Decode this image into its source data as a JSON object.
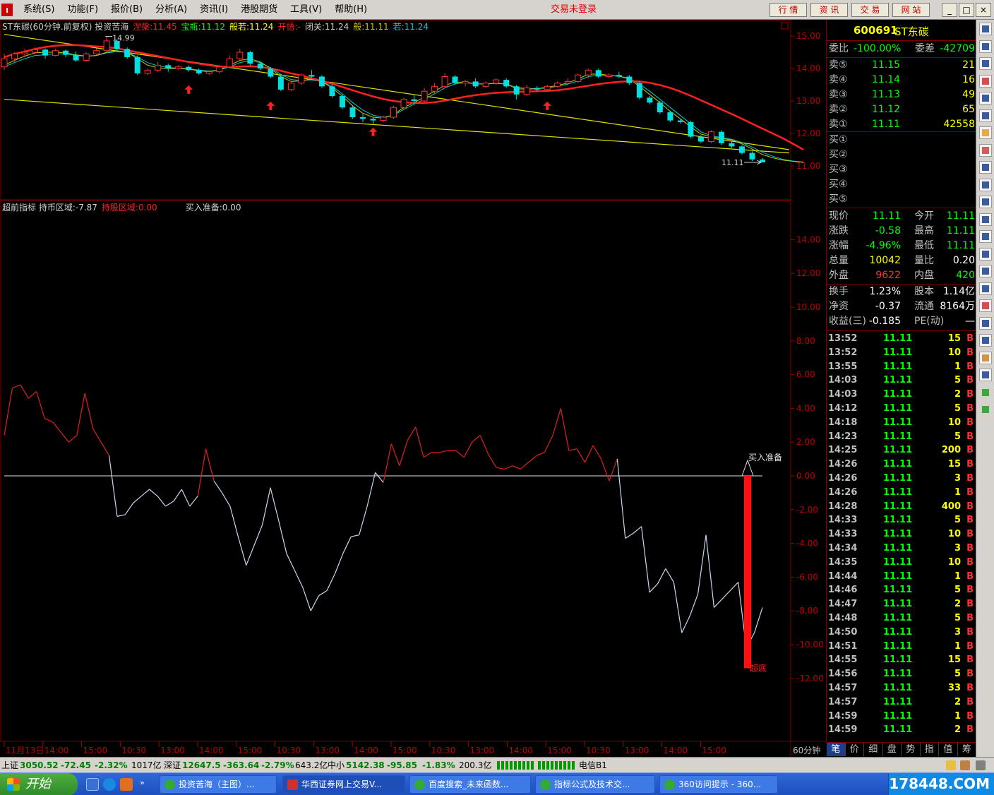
{
  "menubar": {
    "logo": "ı",
    "items": [
      "系统(S)",
      "功能(F)",
      "报价(B)",
      "分析(A)",
      "资讯(I)",
      "港股期货",
      "工具(V)",
      "帮助(H)"
    ],
    "login_status": "交易未登录",
    "nav_buttons": [
      "行 情",
      "资 讯",
      "交 易",
      "网 站"
    ],
    "win_buttons": [
      "_",
      "□",
      "×"
    ]
  },
  "price_chart": {
    "title_parts": [
      {
        "text": "ST东碳(60分钟.前复权) 投资苦海",
        "color": "#d0d0d0"
      },
      {
        "text": "涅槃:11.45",
        "color": "#ff2020"
      },
      {
        "text": "宝瓶:11.12",
        "color": "#00ff00"
      },
      {
        "text": "般若:11.24",
        "color": "#ffff00"
      },
      {
        "text": "开悟:-",
        "color": "#ff2020"
      },
      {
        "text": "闭关:11.24",
        "color": "#d0d0d0"
      },
      {
        "text": "般:11.11",
        "color": "#c8c800"
      },
      {
        "text": "若:11.24",
        "color": "#00cccc"
      }
    ],
    "high_label": "14.99",
    "last_label": "11.11",
    "y_ticks": [
      "15.00",
      "14.00",
      "13.00",
      "12.00",
      "11.00"
    ],
    "candles": [
      {
        "o": 14.05,
        "h": 14.45,
        "l": 13.95,
        "c": 14.3
      },
      {
        "o": 14.3,
        "h": 14.5,
        "l": 14.2,
        "c": 14.45
      },
      {
        "o": 14.45,
        "h": 14.6,
        "l": 14.35,
        "c": 14.5
      },
      {
        "o": 14.5,
        "h": 14.65,
        "l": 14.45,
        "c": 14.58
      },
      {
        "o": 14.58,
        "h": 14.62,
        "l": 14.3,
        "c": 14.4
      },
      {
        "o": 14.4,
        "h": 14.6,
        "l": 14.38,
        "c": 14.55
      },
      {
        "o": 14.55,
        "h": 14.58,
        "l": 14.35,
        "c": 14.42
      },
      {
        "o": 14.42,
        "h": 14.52,
        "l": 14.2,
        "c": 14.25
      },
      {
        "o": 14.25,
        "h": 14.5,
        "l": 14.22,
        "c": 14.45
      },
      {
        "o": 14.45,
        "h": 14.62,
        "l": 14.4,
        "c": 14.55
      },
      {
        "o": 14.55,
        "h": 14.99,
        "l": 14.5,
        "c": 14.85
      },
      {
        "o": 14.85,
        "h": 14.9,
        "l": 14.5,
        "c": 14.6
      },
      {
        "o": 14.6,
        "h": 14.65,
        "l": 14.3,
        "c": 14.35
      },
      {
        "o": 14.35,
        "h": 14.4,
        "l": 13.8,
        "c": 13.85
      },
      {
        "o": 13.85,
        "h": 14.0,
        "l": 13.8,
        "c": 13.95
      },
      {
        "o": 13.95,
        "h": 14.2,
        "l": 13.9,
        "c": 14.1
      },
      {
        "o": 14.1,
        "h": 14.15,
        "l": 13.9,
        "c": 14.0
      },
      {
        "o": 14.0,
        "h": 14.1,
        "l": 13.95,
        "c": 14.05
      },
      {
        "o": 14.05,
        "h": 14.1,
        "l": 13.9,
        "c": 13.95
      },
      {
        "o": 13.95,
        "h": 14.0,
        "l": 13.8,
        "c": 13.85
      },
      {
        "o": 13.85,
        "h": 13.95,
        "l": 13.8,
        "c": 13.9
      },
      {
        "o": 13.9,
        "h": 14.1,
        "l": 13.85,
        "c": 14.05
      },
      {
        "o": 14.05,
        "h": 14.4,
        "l": 14.0,
        "c": 14.3
      },
      {
        "o": 14.3,
        "h": 14.6,
        "l": 14.25,
        "c": 14.5
      },
      {
        "o": 14.5,
        "h": 14.55,
        "l": 14.1,
        "c": 14.15
      },
      {
        "o": 14.15,
        "h": 14.2,
        "l": 13.95,
        "c": 14.0
      },
      {
        "o": 14.0,
        "h": 14.05,
        "l": 13.7,
        "c": 13.75
      },
      {
        "o": 13.75,
        "h": 13.8,
        "l": 13.3,
        "c": 13.35
      },
      {
        "o": 13.35,
        "h": 13.6,
        "l": 13.3,
        "c": 13.55
      },
      {
        "o": 13.55,
        "h": 13.85,
        "l": 13.5,
        "c": 13.8
      },
      {
        "o": 13.8,
        "h": 13.95,
        "l": 13.7,
        "c": 13.75
      },
      {
        "o": 13.75,
        "h": 13.8,
        "l": 13.4,
        "c": 13.45
      },
      {
        "o": 13.45,
        "h": 13.5,
        "l": 13.1,
        "c": 13.15
      },
      {
        "o": 13.15,
        "h": 13.2,
        "l": 12.75,
        "c": 12.8
      },
      {
        "o": 12.8,
        "h": 12.85,
        "l": 12.45,
        "c": 12.5
      },
      {
        "o": 12.5,
        "h": 12.6,
        "l": 12.35,
        "c": 12.45
      },
      {
        "o": 12.45,
        "h": 12.5,
        "l": 12.3,
        "c": 12.4
      },
      {
        "o": 12.4,
        "h": 12.55,
        "l": 12.35,
        "c": 12.5
      },
      {
        "o": 12.5,
        "h": 12.85,
        "l": 12.45,
        "c": 12.8
      },
      {
        "o": 12.8,
        "h": 13.1,
        "l": 12.75,
        "c": 13.05
      },
      {
        "o": 13.05,
        "h": 13.2,
        "l": 12.9,
        "c": 13.0
      },
      {
        "o": 13.0,
        "h": 13.4,
        "l": 12.95,
        "c": 13.3
      },
      {
        "o": 13.3,
        "h": 13.55,
        "l": 13.2,
        "c": 13.45
      },
      {
        "o": 13.45,
        "h": 13.85,
        "l": 13.4,
        "c": 13.75
      },
      {
        "o": 13.75,
        "h": 13.8,
        "l": 13.5,
        "c": 13.55
      },
      {
        "o": 13.55,
        "h": 13.65,
        "l": 13.45,
        "c": 13.6
      },
      {
        "o": 13.6,
        "h": 13.7,
        "l": 13.4,
        "c": 13.45
      },
      {
        "o": 13.45,
        "h": 13.6,
        "l": 13.4,
        "c": 13.55
      },
      {
        "o": 13.55,
        "h": 13.7,
        "l": 13.5,
        "c": 13.65
      },
      {
        "o": 13.65,
        "h": 13.7,
        "l": 13.4,
        "c": 13.45
      },
      {
        "o": 13.45,
        "h": 13.5,
        "l": 13.05,
        "c": 13.2
      },
      {
        "o": 13.2,
        "h": 13.5,
        "l": 13.15,
        "c": 13.4
      },
      {
        "o": 13.4,
        "h": 13.45,
        "l": 13.3,
        "c": 13.35
      },
      {
        "o": 13.35,
        "h": 13.5,
        "l": 13.3,
        "c": 13.45
      },
      {
        "o": 13.45,
        "h": 13.6,
        "l": 13.4,
        "c": 13.55
      },
      {
        "o": 13.55,
        "h": 13.7,
        "l": 13.5,
        "c": 13.6
      },
      {
        "o": 13.6,
        "h": 13.85,
        "l": 13.55,
        "c": 13.8
      },
      {
        "o": 13.8,
        "h": 14.0,
        "l": 13.7,
        "c": 13.95
      },
      {
        "o": 13.95,
        "h": 14.0,
        "l": 13.7,
        "c": 13.75
      },
      {
        "o": 13.75,
        "h": 13.85,
        "l": 13.7,
        "c": 13.8
      },
      {
        "o": 13.8,
        "h": 13.9,
        "l": 13.7,
        "c": 13.75
      },
      {
        "o": 13.75,
        "h": 13.8,
        "l": 13.5,
        "c": 13.55
      },
      {
        "o": 13.55,
        "h": 13.6,
        "l": 13.05,
        "c": 13.1
      },
      {
        "o": 13.1,
        "h": 13.15,
        "l": 12.9,
        "c": 12.95
      },
      {
        "o": 12.95,
        "h": 13.0,
        "l": 12.6,
        "c": 12.65
      },
      {
        "o": 12.65,
        "h": 12.7,
        "l": 12.35,
        "c": 12.4
      },
      {
        "o": 12.4,
        "h": 12.45,
        "l": 12.3,
        "c": 12.35
      },
      {
        "o": 12.35,
        "h": 12.4,
        "l": 11.85,
        "c": 11.9
      },
      {
        "o": 11.9,
        "h": 11.95,
        "l": 11.7,
        "c": 11.75
      },
      {
        "o": 11.75,
        "h": 12.1,
        "l": 11.7,
        "c": 12.05
      },
      {
        "o": 12.05,
        "h": 12.1,
        "l": 11.65,
        "c": 11.7
      },
      {
        "o": 11.7,
        "h": 11.75,
        "l": 11.55,
        "c": 11.6
      },
      {
        "o": 11.6,
        "h": 11.65,
        "l": 11.35,
        "c": 11.4
      },
      {
        "o": 11.4,
        "h": 11.45,
        "l": 11.15,
        "c": 11.2
      },
      {
        "o": 11.2,
        "h": 11.25,
        "l": 11.11,
        "c": 11.11
      }
    ],
    "ma_red": [
      14.35,
      14.45,
      14.52,
      14.6,
      14.66,
      14.7,
      14.72,
      14.72,
      14.7,
      14.68,
      14.66,
      14.62,
      14.56,
      14.5,
      14.44,
      14.38,
      14.32,
      14.26,
      14.2,
      14.15,
      14.1,
      14.06,
      14.05,
      14.06,
      14.07,
      14.05,
      14.0,
      13.93,
      13.85,
      13.78,
      13.7,
      13.62,
      13.53,
      13.43,
      13.33,
      13.23,
      13.14,
      13.06,
      13.0,
      12.96,
      12.94,
      12.94,
      12.96,
      13.01,
      13.07,
      13.13,
      13.18,
      13.22,
      13.25,
      13.27,
      13.28,
      13.29,
      13.3,
      13.31,
      13.33,
      13.37,
      13.42,
      13.47,
      13.52,
      13.56,
      13.59,
      13.61,
      13.6,
      13.56,
      13.49,
      13.4,
      13.29,
      13.16,
      13.02,
      12.88,
      12.74,
      12.6,
      12.45,
      12.3,
      12.15,
      12.0,
      11.85,
      11.68,
      11.5
    ],
    "ma_yellow": [
      14.1,
      14.25,
      14.38,
      14.48,
      14.5,
      14.5,
      14.48,
      14.42,
      14.38,
      14.4,
      14.5,
      14.55,
      14.5,
      14.3,
      14.1,
      14.02,
      14.0,
      14.0,
      13.98,
      13.93,
      13.9,
      13.95,
      14.1,
      14.25,
      14.3,
      14.2,
      14.0,
      13.75,
      13.6,
      13.62,
      13.68,
      13.6,
      13.4,
      13.15,
      12.85,
      12.62,
      12.5,
      12.47,
      12.58,
      12.8,
      12.95,
      13.12,
      13.3,
      13.48,
      13.58,
      13.58,
      13.53,
      13.52,
      13.55,
      13.52,
      13.38,
      13.36,
      13.38,
      13.42,
      13.48,
      13.55,
      13.68,
      13.82,
      13.83,
      13.79,
      13.76,
      13.68,
      13.45,
      13.2,
      12.95,
      12.68,
      12.45,
      12.2,
      11.98,
      11.9,
      11.85,
      11.8,
      11.68,
      11.52,
      11.35,
      11.25,
      11.18,
      11.14,
      11.11
    ],
    "ma_cyan": [
      14.05,
      14.18,
      14.3,
      14.4,
      14.42,
      14.45,
      14.45,
      14.4,
      14.38,
      14.4,
      14.48,
      14.52,
      14.5,
      14.35,
      14.18,
      14.08,
      14.03,
      14.01,
      13.99,
      13.95,
      13.92,
      13.95,
      14.05,
      14.18,
      14.25,
      14.18,
      14.02,
      13.82,
      13.66,
      13.63,
      13.65,
      13.6,
      13.45,
      13.22,
      12.95,
      12.72,
      12.56,
      12.5,
      12.56,
      12.74,
      12.9,
      13.05,
      13.22,
      13.4,
      13.53,
      13.56,
      13.53,
      13.52,
      13.54,
      13.52,
      13.42,
      13.38,
      13.38,
      13.4,
      13.45,
      13.52,
      13.62,
      13.75,
      13.79,
      13.78,
      13.76,
      13.7,
      13.52,
      13.3,
      13.05,
      12.8,
      12.55,
      12.3,
      12.05,
      11.93,
      11.87,
      11.82,
      11.72,
      11.58,
      11.42,
      11.3,
      11.2,
      11.15,
      11.12
    ],
    "channel_upper": [
      15.05,
      11.5
    ],
    "channel_lower": [
      13.05,
      11.4
    ],
    "buy_arrows": [
      {
        "i": 18,
        "p": 13.35
      },
      {
        "i": 26,
        "p": 12.85
      },
      {
        "i": 36,
        "p": 12.05
      },
      {
        "i": 53,
        "p": 12.85
      }
    ]
  },
  "indicator_chart": {
    "title_parts": [
      {
        "text": "超前指标  持币区域:-7.87",
        "color": "#d0d0d0"
      },
      {
        "text": "持股区域:0.00",
        "color": "#ff2020"
      },
      {
        "text": "买入准备:0.00",
        "color": "#d0d0d0"
      }
    ],
    "y_ticks": [
      "14.00",
      "12.00",
      "10.00",
      "8.00",
      "6.00",
      "4.00",
      "2.00",
      "0.00",
      "-2.00",
      "-4.00",
      "-6.00",
      "-8.00",
      "-10.00",
      "-12.00"
    ],
    "values": [
      2.4,
      5.2,
      5.4,
      4.6,
      5.0,
      3.4,
      3.2,
      2.6,
      2.0,
      2.4,
      4.9,
      2.8,
      2.0,
      1.2,
      -2.4,
      -2.3,
      -1.6,
      -1.2,
      -0.8,
      -1.2,
      -1.8,
      -1.5,
      -0.8,
      -1.8,
      -1.2,
      1.6,
      -0.3,
      -1.0,
      -1.8,
      -3.6,
      -5.3,
      -4.1,
      -2.9,
      -0.7,
      -2.6,
      -4.6,
      -5.6,
      -6.6,
      -8.0,
      -7.1,
      -6.8,
      -5.8,
      -4.6,
      -3.6,
      -3.5,
      -1.8,
      0.2,
      -0.4,
      1.9,
      0.6,
      2.1,
      2.9,
      1.1,
      1.4,
      1.4,
      1.5,
      1.5,
      1.1,
      2.0,
      2.4,
      1.3,
      0.5,
      0.4,
      0.6,
      0.4,
      0.8,
      1.2,
      1.4,
      2.4,
      4.0,
      1.5,
      1.6,
      0.8,
      1.8,
      1.0,
      -0.3,
      1.0,
      -3.7,
      -3.4,
      -3.0,
      -6.9,
      -6.4,
      -5.5,
      -6.3,
      -9.3,
      -8.3,
      -7.0,
      -3.5,
      -7.8,
      -7.3,
      -6.8,
      -6.3,
      -10.2,
      -9.3,
      -7.8
    ],
    "buy_label": "买入准备",
    "bottom_label": "超底",
    "bottom_bar_value": -11.4
  },
  "x_axis": {
    "labels": [
      "11月13日",
      "14:00",
      "15:00",
      "10:30",
      "13:00",
      "14:00",
      "15:00",
      "10:30",
      "13:00",
      "14:00",
      "15:00",
      "10:30",
      "13:00",
      "14:00",
      "15:00",
      "10:30",
      "13:00",
      "14:00",
      "15:00"
    ],
    "period": "60分钟"
  },
  "quote": {
    "code": "600691",
    "name": "ST东碳",
    "weibi_label": "委比",
    "weibi": "-100.00%",
    "weicha_label": "委差",
    "weicha": "-42709",
    "asks": [
      {
        "label": "卖⑤",
        "price": "11.15",
        "vol": "21"
      },
      {
        "label": "卖④",
        "price": "11.14",
        "vol": "16"
      },
      {
        "label": "卖③",
        "price": "11.13",
        "vol": "49"
      },
      {
        "label": "卖②",
        "price": "11.12",
        "vol": "65"
      },
      {
        "label": "卖①",
        "price": "11.11",
        "vol": "42558"
      }
    ],
    "bids": [
      {
        "label": "买①"
      },
      {
        "label": "买②"
      },
      {
        "label": "买③"
      },
      {
        "label": "买④"
      },
      {
        "label": "买⑤"
      }
    ],
    "stats1": [
      {
        "l1": "现价",
        "v1": "11.11",
        "c1": "#00ff00",
        "l2": "今开",
        "v2": "11.11",
        "c2": "#00ff00"
      },
      {
        "l1": "涨跌",
        "v1": "-0.58",
        "c1": "#00ff00",
        "l2": "最高",
        "v2": "11.11",
        "c2": "#00ff00"
      },
      {
        "l1": "涨幅",
        "v1": "-4.96%",
        "c1": "#00ff00",
        "l2": "最低",
        "v2": "11.11",
        "c2": "#00ff00"
      },
      {
        "l1": "总量",
        "v1": "10042",
        "c1": "#ffff00",
        "l2": "量比",
        "v2": "0.20",
        "c2": "#ffffff"
      },
      {
        "l1": "外盘",
        "v1": "9622",
        "c1": "#ff3030",
        "l2": "内盘",
        "v2": "420",
        "c2": "#00ff00"
      }
    ],
    "stats2": [
      {
        "l1": "换手",
        "v1": "1.23%",
        "c1": "#ffffff",
        "l2": "股本",
        "v2": "1.14亿",
        "c2": "#ffffff"
      },
      {
        "l1": "净资",
        "v1": "-0.37",
        "c1": "#ffffff",
        "l2": "流通",
        "v2": "8164万",
        "c2": "#ffffff"
      },
      {
        "l1": "收益(三)",
        "v1": "-0.185",
        "c1": "#ffffff",
        "l2": "PE(动)",
        "v2": "—",
        "c2": "#ffffff"
      }
    ],
    "ticks": [
      {
        "t": "13:52",
        "p": "11.11",
        "v": "15",
        "s": "B"
      },
      {
        "t": "13:52",
        "p": "11.11",
        "v": "10",
        "s": "B"
      },
      {
        "t": "13:55",
        "p": "11.11",
        "v": "1",
        "s": "B"
      },
      {
        "t": "14:03",
        "p": "11.11",
        "v": "5",
        "s": "B"
      },
      {
        "t": "14:03",
        "p": "11.11",
        "v": "2",
        "s": "B"
      },
      {
        "t": "14:12",
        "p": "11.11",
        "v": "5",
        "s": "B"
      },
      {
        "t": "14:18",
        "p": "11.11",
        "v": "10",
        "s": "B"
      },
      {
        "t": "14:23",
        "p": "11.11",
        "v": "5",
        "s": "B"
      },
      {
        "t": "14:25",
        "p": "11.11",
        "v": "200",
        "s": "B"
      },
      {
        "t": "14:26",
        "p": "11.11",
        "v": "15",
        "s": "B"
      },
      {
        "t": "14:26",
        "p": "11.11",
        "v": "3",
        "s": "B"
      },
      {
        "t": "14:26",
        "p": "11.11",
        "v": "1",
        "s": "B"
      },
      {
        "t": "14:28",
        "p": "11.11",
        "v": "400",
        "s": "B"
      },
      {
        "t": "14:33",
        "p": "11.11",
        "v": "5",
        "s": "B"
      },
      {
        "t": "14:33",
        "p": "11.11",
        "v": "10",
        "s": "B"
      },
      {
        "t": "14:34",
        "p": "11.11",
        "v": "3",
        "s": "B"
      },
      {
        "t": "14:35",
        "p": "11.11",
        "v": "10",
        "s": "B"
      },
      {
        "t": "14:44",
        "p": "11.11",
        "v": "1",
        "s": "B"
      },
      {
        "t": "14:46",
        "p": "11.11",
        "v": "5",
        "s": "B"
      },
      {
        "t": "14:47",
        "p": "11.11",
        "v": "2",
        "s": "B"
      },
      {
        "t": "14:48",
        "p": "11.11",
        "v": "5",
        "s": "B"
      },
      {
        "t": "14:50",
        "p": "11.11",
        "v": "3",
        "s": "B"
      },
      {
        "t": "14:51",
        "p": "11.11",
        "v": "1",
        "s": "B"
      },
      {
        "t": "14:55",
        "p": "11.11",
        "v": "15",
        "s": "B"
      },
      {
        "t": "14:56",
        "p": "11.11",
        "v": "5",
        "s": "B"
      },
      {
        "t": "14:57",
        "p": "11.11",
        "v": "33",
        "s": "B"
      },
      {
        "t": "14:57",
        "p": "11.11",
        "v": "2",
        "s": "B"
      },
      {
        "t": "14:59",
        "p": "11.11",
        "v": "1",
        "s": "B"
      },
      {
        "t": "14:59",
        "p": "11.11",
        "v": "2",
        "s": "B"
      }
    ],
    "tabs": [
      "笔",
      "价",
      "细",
      "盘",
      "势",
      "指",
      "值",
      "筹"
    ]
  },
  "status": {
    "sh_label": "上证",
    "sh_value": "3050.52",
    "sh_change": "-72.45",
    "sh_pct": "-2.32%",
    "sh_amount": "1017亿",
    "sz_label": "深证",
    "sz_value": "12647.5",
    "sz_change": "-363.64",
    "sz_pct": "-2.79%",
    "sz_amount": "643.2亿",
    "zx_label": "中小",
    "zx_value": "5142.38",
    "zx_change": "-95.85",
    "zx_pct": "-1.83%",
    "zx_amount": "200.3亿",
    "server": "电信B1"
  },
  "taskbar": {
    "start_label": "开始",
    "tasks": [
      "投资苦海（主图）...",
      "华西证券网上交易V...",
      "百度搜索_未来函数...",
      "指标公式及技术交...",
      "360访问提示 - 360..."
    ],
    "watermark": "178448.COM"
  }
}
